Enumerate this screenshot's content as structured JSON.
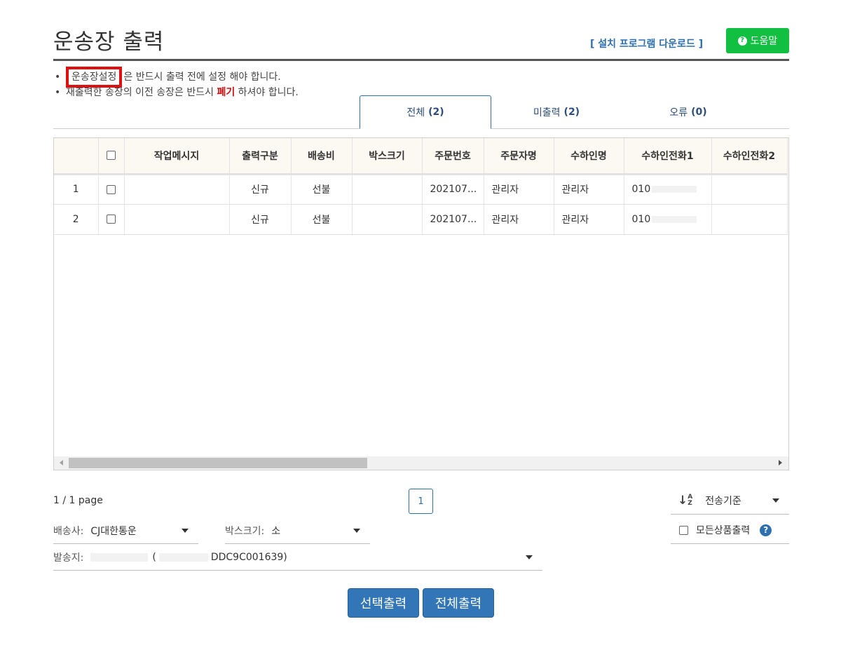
{
  "header": {
    "title": "운송장 출력",
    "install_link": "[ 설치 프로그램 다운로드 ]",
    "help_button": "도움말"
  },
  "notices": {
    "line1_link": "운송장설정",
    "line1_text": "은 반드시 출력 전에 설정 해야 합니다.",
    "line2_before": "재출력한 송장의 이전 송장은 반드시",
    "line2_highlight": "폐기",
    "line2_after": "하셔야 합니다."
  },
  "tabs": [
    {
      "label": "전체",
      "count": "(2)"
    },
    {
      "label": "미출력",
      "count": "(2)"
    },
    {
      "label": "오류",
      "count": "(0)"
    }
  ],
  "grid": {
    "columns": [
      "작업메시지",
      "출력구분",
      "배송비",
      "박스크기",
      "주문번호",
      "주문자명",
      "수하인명",
      "수하인전화1",
      "수하인전화2"
    ],
    "rows": [
      {
        "no": "1",
        "message": "",
        "type": "신규",
        "fee": "선불",
        "box": "",
        "order_no": "202107...",
        "orderer": "관리자",
        "receiver": "관리자",
        "phone1": "010",
        "phone2": ""
      },
      {
        "no": "2",
        "message": "",
        "type": "신규",
        "fee": "선불",
        "box": "",
        "order_no": "202107...",
        "orderer": "관리자",
        "receiver": "관리자",
        "phone1": "010",
        "phone2": ""
      }
    ]
  },
  "pagination": {
    "info": "1 / 1 page",
    "current": "1"
  },
  "controls": {
    "sort_label": "전송기준",
    "all_products_label": "모든상품출력",
    "carrier_label": "배송사:",
    "carrier_value": "CJ대한통운",
    "box_label": "박스크기:",
    "box_value": "소",
    "origin_label": "발송지:",
    "origin_open": "(",
    "origin_code": "DDC9C001639)"
  },
  "buttons": {
    "print_selected": "선택출력",
    "print_all": "전체출력"
  },
  "colors": {
    "accent_blue": "#3276b8",
    "help_green": "#11c040",
    "highlight_red": "#e01010"
  }
}
